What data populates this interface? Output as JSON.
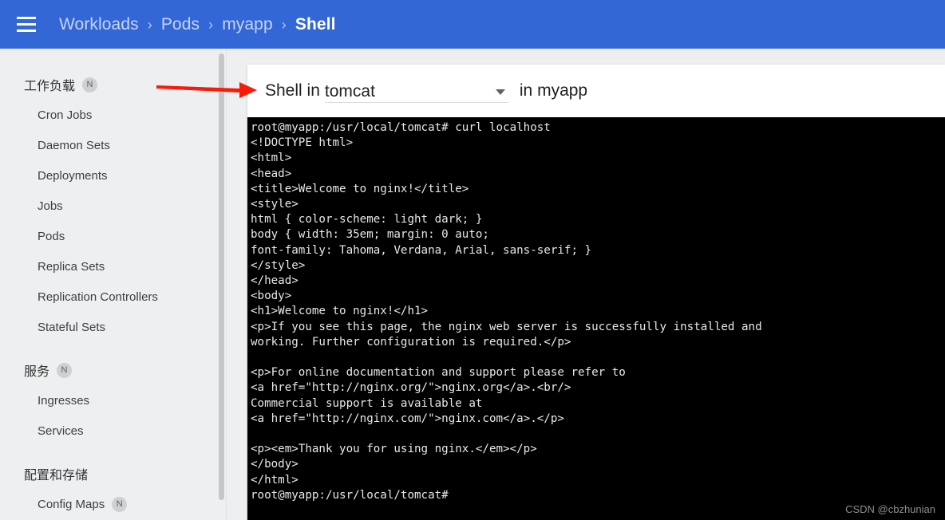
{
  "topbar": {
    "menu_icon": "hamburger-menu-icon",
    "breadcrumb": [
      {
        "label": "Workloads",
        "active": false
      },
      {
        "label": "Pods",
        "active": false
      },
      {
        "label": "myapp",
        "active": false
      },
      {
        "label": "Shell",
        "active": true
      }
    ],
    "separator": "›",
    "background_color": "#3367d6"
  },
  "sidebar": {
    "background_color": "#eeeff0",
    "groups": [
      {
        "title": "工作负载",
        "badge": "N",
        "items": [
          {
            "label": "Cron Jobs",
            "badge": ""
          },
          {
            "label": "Daemon Sets",
            "badge": ""
          },
          {
            "label": "Deployments",
            "badge": ""
          },
          {
            "label": "Jobs",
            "badge": ""
          },
          {
            "label": "Pods",
            "badge": ""
          },
          {
            "label": "Replica Sets",
            "badge": ""
          },
          {
            "label": "Replication Controllers",
            "badge": ""
          },
          {
            "label": "Stateful Sets",
            "badge": ""
          }
        ]
      },
      {
        "title": "服务",
        "badge": "N",
        "items": [
          {
            "label": "Ingresses",
            "badge": ""
          },
          {
            "label": "Services",
            "badge": ""
          }
        ]
      },
      {
        "title": "配置和存储",
        "badge": "",
        "items": [
          {
            "label": "Config Maps",
            "badge": "N"
          }
        ]
      }
    ]
  },
  "shell_panel": {
    "prefix_label": "Shell in",
    "container_select": {
      "value": "tomcat",
      "caret_icon": "chevron-down-icon"
    },
    "namespace_label": "in myapp"
  },
  "terminal": {
    "background_color": "#000000",
    "foreground_color": "#e8e8e8",
    "lines": "root@myapp:/usr/local/tomcat# curl localhost\n<!DOCTYPE html>\n<html>\n<head>\n<title>Welcome to nginx!</title>\n<style>\nhtml { color-scheme: light dark; }\nbody { width: 35em; margin: 0 auto;\nfont-family: Tahoma, Verdana, Arial, sans-serif; }\n</style>\n</head>\n<body>\n<h1>Welcome to nginx!</h1>\n<p>If you see this page, the nginx web server is successfully installed and\nworking. Further configuration is required.</p>\n\n<p>For online documentation and support please refer to\n<a href=\"http://nginx.org/\">nginx.org</a>.<br/>\nCommercial support is available at\n<a href=\"http://nginx.com/\">nginx.com</a>.</p>\n\n<p><em>Thank you for using nginx.</em></p>\n</body>\n</html>\nroot@myapp:/usr/local/tomcat#"
  },
  "annotation": {
    "arrow_color": "#f91b0a",
    "arrow_direction": "right",
    "points_to": "Shell in tomcat selector"
  },
  "watermark": {
    "text": "CSDN @cbzhunian"
  }
}
